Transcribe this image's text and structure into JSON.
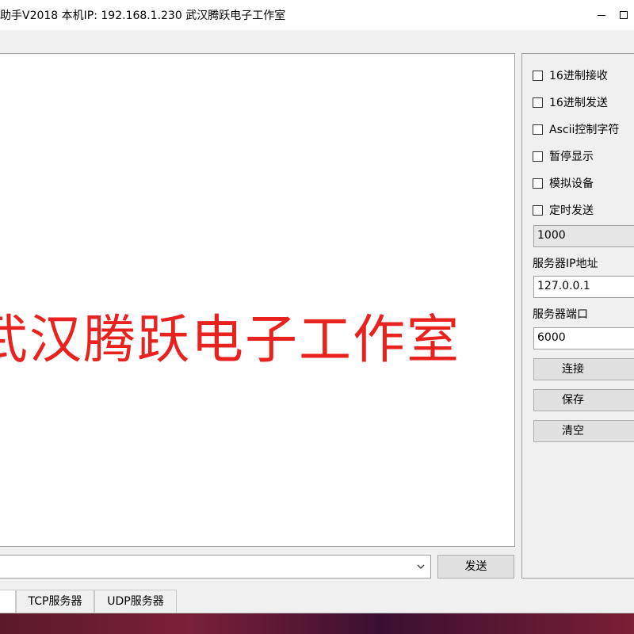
{
  "window": {
    "title": "助手V2018  本机IP: 192.168.1.230  武汉腾跃电子工作室"
  },
  "receive": {
    "text": "武汉腾跃电子工作室",
    "text_color": "#e8231f"
  },
  "options": {
    "hex_receive": "16进制接收",
    "hex_send": "16进制发送",
    "ascii_ctrl": "Ascii控制字符",
    "pause_display": "暂停显示",
    "simulate_device": "模拟设备",
    "timed_send": "定时发送"
  },
  "timer": {
    "interval_value": "1000"
  },
  "server": {
    "ip_label": "服务器IP地址",
    "ip_value": "127.0.0.1",
    "port_label": "服务器端口",
    "port_value": "6000"
  },
  "buttons": {
    "connect": "连接",
    "save": "保存",
    "clear": "清空",
    "send": "发送"
  },
  "tabs": [
    {
      "label": "TCP服务器"
    },
    {
      "label": "UDP服务器"
    }
  ],
  "icons": {
    "dropdown": "chevron-down-icon",
    "minimize": "minimize-icon",
    "maximize": "maximize-icon"
  }
}
